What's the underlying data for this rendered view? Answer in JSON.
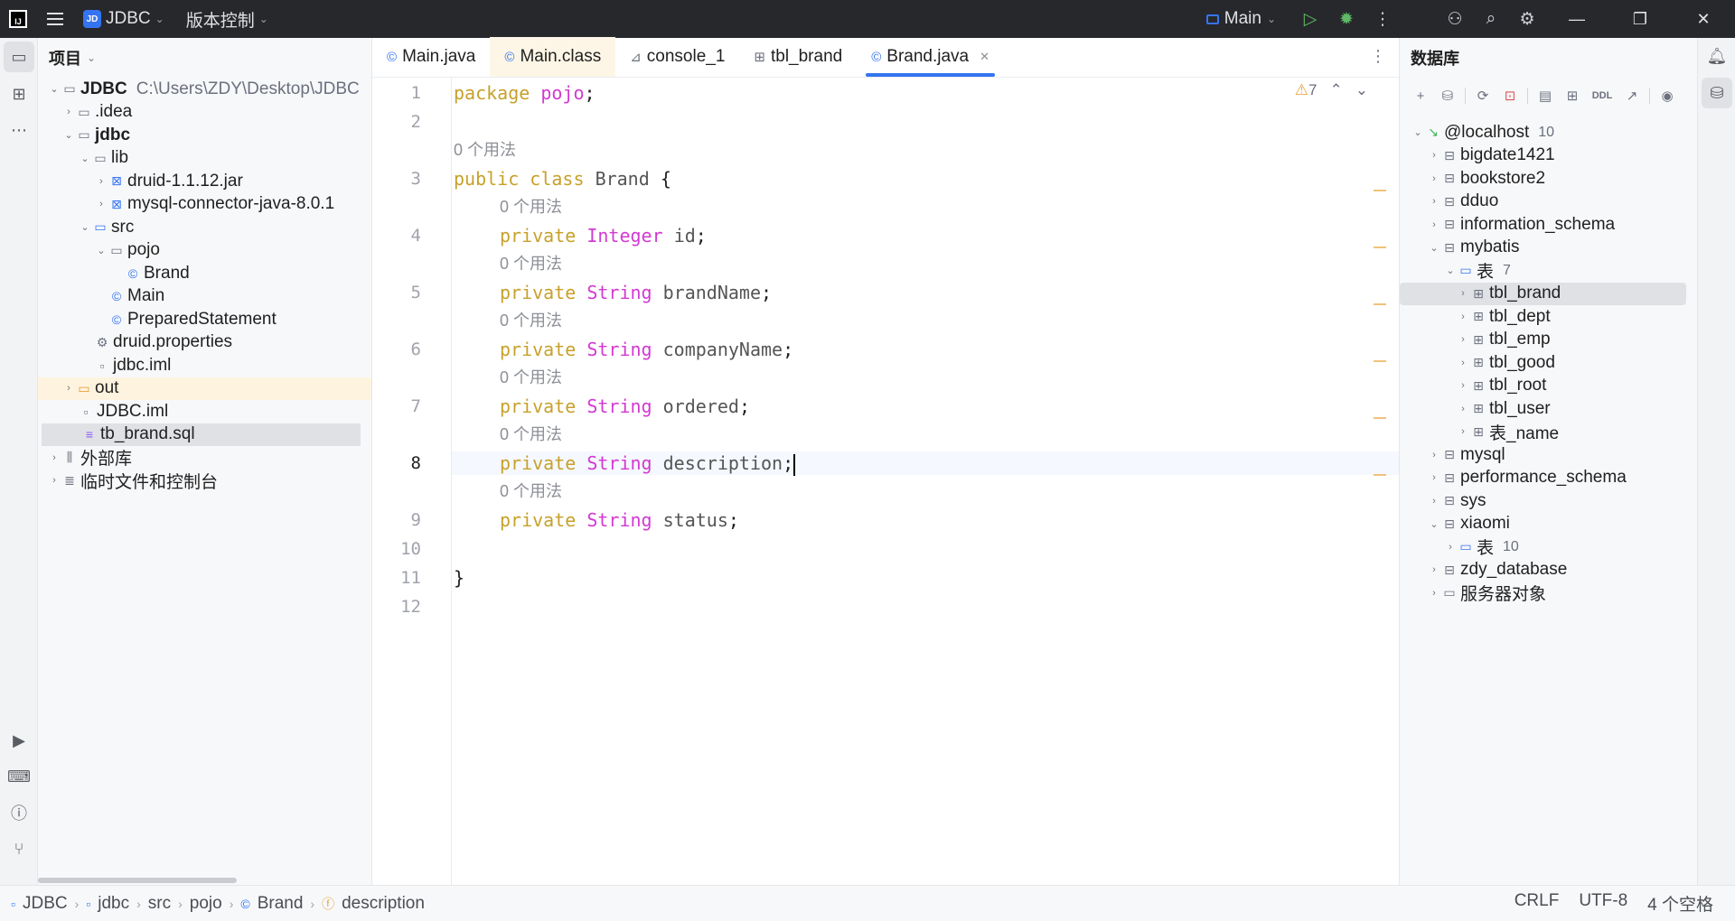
{
  "titlebar": {
    "project_badge": "JD",
    "project_name": "JDBC",
    "vcs": "版本控制",
    "run_config": "Main"
  },
  "project_panel": {
    "title": "项目",
    "root_name": "JDBC",
    "root_path": "C:\\Users\\ZDY\\Desktop\\JDBC",
    "items": [
      {
        "label": ".idea"
      },
      {
        "label": "jdbc"
      },
      {
        "label": "lib"
      },
      {
        "label": "druid-1.1.12.jar"
      },
      {
        "label": "mysql-connector-java-8.0.1"
      },
      {
        "label": "src"
      },
      {
        "label": "pojo"
      },
      {
        "label": "Brand"
      },
      {
        "label": "Main"
      },
      {
        "label": "PreparedStatement"
      },
      {
        "label": "druid.properties"
      },
      {
        "label": "jdbc.iml"
      },
      {
        "label": "out"
      },
      {
        "label": "JDBC.iml"
      },
      {
        "label": "tb_brand.sql"
      },
      {
        "label": "外部库"
      },
      {
        "label": "临时文件和控制台"
      }
    ]
  },
  "tabs": [
    {
      "label": "Main.java"
    },
    {
      "label": "Main.class"
    },
    {
      "label": "console_1"
    },
    {
      "label": "tbl_brand"
    },
    {
      "label": "Brand.java"
    }
  ],
  "editor": {
    "warnings": "7",
    "usage_hint": "0 个用法",
    "line_numbers": [
      "1",
      "2",
      "3",
      "4",
      "5",
      "6",
      "7",
      "8",
      "9",
      "10",
      "11",
      "12"
    ],
    "kw_package": "package",
    "pkg_name": "pojo",
    "semi": ";",
    "kw_public": "public",
    "kw_class": "class",
    "class_name": "Brand",
    "open_brace": "{",
    "close_brace": "}",
    "kw_private": "private",
    "fields": [
      {
        "type": "Integer",
        "name": "id"
      },
      {
        "type": "String",
        "name": "brandName"
      },
      {
        "type": "String",
        "name": "companyName"
      },
      {
        "type": "String",
        "name": "ordered"
      },
      {
        "type": "String",
        "name": "description"
      },
      {
        "type": "String",
        "name": "status"
      }
    ]
  },
  "db_panel": {
    "title": "数据库",
    "tool_ddl": "DDL",
    "host": "@localhost",
    "host_count": "10",
    "schemas": [
      {
        "label": "bigdate1421"
      },
      {
        "label": "bookstore2"
      },
      {
        "label": "dduo"
      },
      {
        "label": "information_schema"
      },
      {
        "label": "mybatis"
      }
    ],
    "tables_folder": "表",
    "tables_count": "7",
    "tables": [
      "tbl_brand",
      "tbl_dept",
      "tbl_emp",
      "tbl_good",
      "tbl_root",
      "tbl_user",
      "表_name"
    ],
    "schemas2": [
      {
        "label": "mysql"
      },
      {
        "label": "performance_schema"
      },
      {
        "label": "sys"
      },
      {
        "label": "xiaomi"
      }
    ],
    "xiaomi_folder": "表",
    "xiaomi_count": "10",
    "schemas3": [
      {
        "label": "zdy_database"
      },
      {
        "label": "服务器对象"
      }
    ]
  },
  "statusbar": {
    "crumbs": [
      "JDBC",
      "jdbc",
      "src",
      "pojo",
      "Brand",
      "description"
    ],
    "line_sep": "CRLF",
    "encoding": "UTF-8",
    "indent": "4 个空格"
  }
}
